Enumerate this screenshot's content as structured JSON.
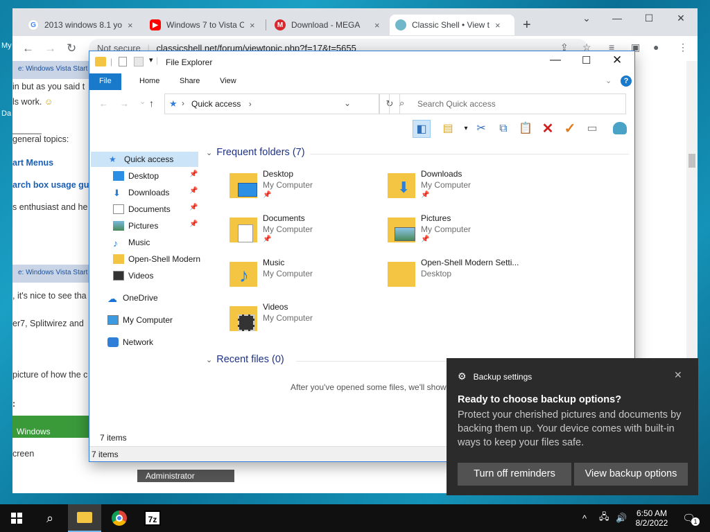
{
  "browser": {
    "tabs": [
      {
        "title": "2013 windows 8.1 yo",
        "close": "×"
      },
      {
        "title": "Windows 7 to Vista C",
        "close": "×"
      },
      {
        "title": "Download - MEGA",
        "close": "×"
      },
      {
        "title": "Classic Shell • View t",
        "close": "×"
      }
    ],
    "new_tab": "+",
    "url_security": "Not secure",
    "url": "classicshell.net/forum/viewtopic.php?f=17&t=5655"
  },
  "page_bg": {
    "bar1": "e: Windows Vista Start",
    "line1": "in but as you said t",
    "line2": "ls work.",
    "line3": "______",
    "line4": "general topics:",
    "link1": "art Menus",
    "link2": "arch box usage gui",
    "line5": "s enthusiast and he",
    "bar2": "e: Windows Vista Start",
    "line6": ", it's nice to see tha",
    "line7": "er7, Splitwirez and",
    "line8": "picture of how the c",
    "line9": ":",
    "windows": "Windows",
    "screen": "creen",
    "admin": "Administrator",
    "side_my": "My",
    "side_da": "Da"
  },
  "explorer": {
    "title": "File Explorer",
    "ribbon_tabs": [
      "File",
      "Home",
      "Share",
      "View"
    ],
    "help": "?",
    "address": "Quick access",
    "search_placeholder": "Search Quick access",
    "nav": [
      {
        "label": "Quick access"
      },
      {
        "label": "Desktop"
      },
      {
        "label": "Downloads"
      },
      {
        "label": "Documents"
      },
      {
        "label": "Pictures"
      },
      {
        "label": "Music"
      },
      {
        "label": "Open-Shell Modern"
      },
      {
        "label": "Videos"
      },
      {
        "label": "OneDrive"
      },
      {
        "label": "My Computer"
      },
      {
        "label": "Network"
      }
    ],
    "frequent_header": "Frequent folders (7)",
    "folders": [
      {
        "name": "Desktop",
        "sub": "My Computer"
      },
      {
        "name": "Downloads",
        "sub": "My Computer"
      },
      {
        "name": "Documents",
        "sub": "My Computer"
      },
      {
        "name": "Pictures",
        "sub": "My Computer"
      },
      {
        "name": "Music",
        "sub": "My Computer"
      },
      {
        "name": "Open-Shell Modern Setti...",
        "sub": "Desktop"
      },
      {
        "name": "Videos",
        "sub": "My Computer"
      }
    ],
    "recent_header": "Recent files (0)",
    "recent_empty": "After you've opened some files, we'll show",
    "status_inner": "7 items",
    "status_outer": "7 items"
  },
  "toast": {
    "app": "Backup settings",
    "title": "Ready to choose backup options?",
    "body": "Protect your cherished pictures and documents by backing them up. Your device comes with built-in ways to keep your files safe.",
    "btn1": "Turn off reminders",
    "btn2": "View backup options"
  },
  "taskbar": {
    "time": "6:50 AM",
    "date": "8/2/2022",
    "notif_count": "1",
    "sevenzip": "7z"
  }
}
